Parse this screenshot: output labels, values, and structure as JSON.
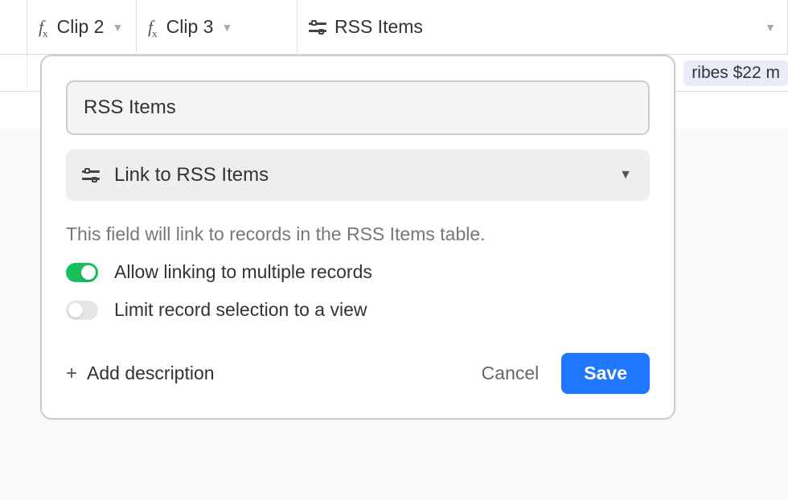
{
  "columns": {
    "clip2": "Clip 2",
    "clip3": "Clip 3",
    "rss": "RSS Items"
  },
  "row": {
    "chip": "ribes $22 m"
  },
  "popover": {
    "field_name": "RSS Items",
    "field_type_label": "Link to RSS Items",
    "help_text": "This field will link to records in the RSS Items table.",
    "allow_multi_label": "Allow linking to multiple records",
    "limit_view_label": "Limit record selection to a view",
    "add_desc_label": "Add description",
    "cancel_label": "Cancel",
    "save_label": "Save",
    "toggles": {
      "allow_multi": true,
      "limit_view": false
    }
  }
}
